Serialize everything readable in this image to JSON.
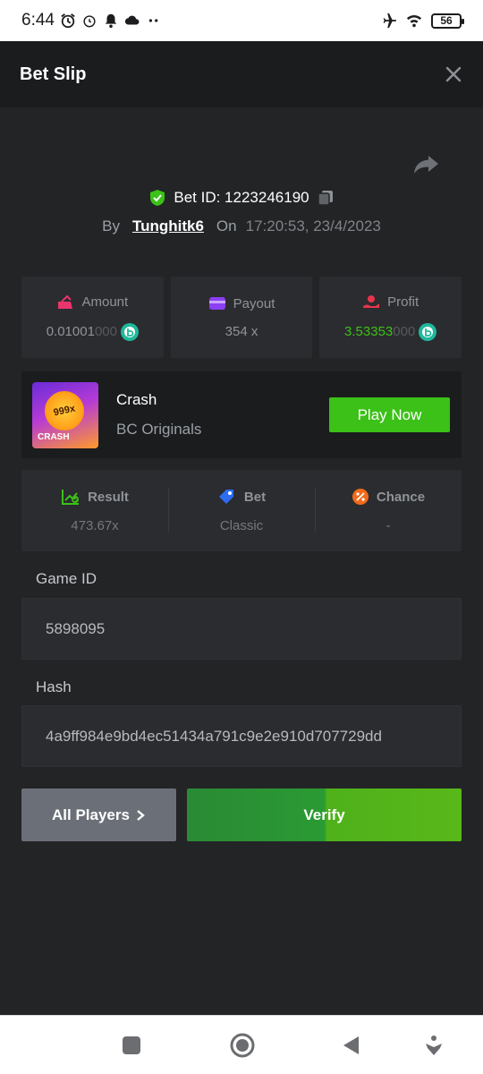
{
  "status_bar": {
    "time": "6:44",
    "battery": "56"
  },
  "header": {
    "title": "Bet Slip"
  },
  "bet": {
    "id_label": "Bet ID: 1223246190",
    "by_label": "By",
    "user": "Tunghitk6",
    "on_label": "On",
    "datetime": "17:20:53, 23/4/2023"
  },
  "stats": {
    "amount": {
      "label": "Amount",
      "value_main": "0.01001",
      "value_dim": "000"
    },
    "payout": {
      "label": "Payout",
      "value": "354 x"
    },
    "profit": {
      "label": "Profit",
      "value_main": "3.53353",
      "value_dim": "000"
    }
  },
  "game": {
    "name": "Crash",
    "provider": "BC Originals",
    "thumb_badge": "999x",
    "thumb_title": "CRASH",
    "play_label": "Play Now"
  },
  "info": {
    "result": {
      "label": "Result",
      "value": "473.67x"
    },
    "bet": {
      "label": "Bet",
      "value": "Classic"
    },
    "chance": {
      "label": "Chance",
      "value": "-"
    }
  },
  "fields": {
    "game_id_label": "Game ID",
    "game_id_value": "5898095",
    "hash_label": "Hash",
    "hash_value": "4a9ff984e9bd4ec51434a791c9e2e910d707729dd"
  },
  "actions": {
    "all_players_label": "All Players",
    "verify_label": "Verify"
  },
  "colors": {
    "accent_green": "#3bc117",
    "background": "#232426",
    "card": "#2b2c2f"
  }
}
